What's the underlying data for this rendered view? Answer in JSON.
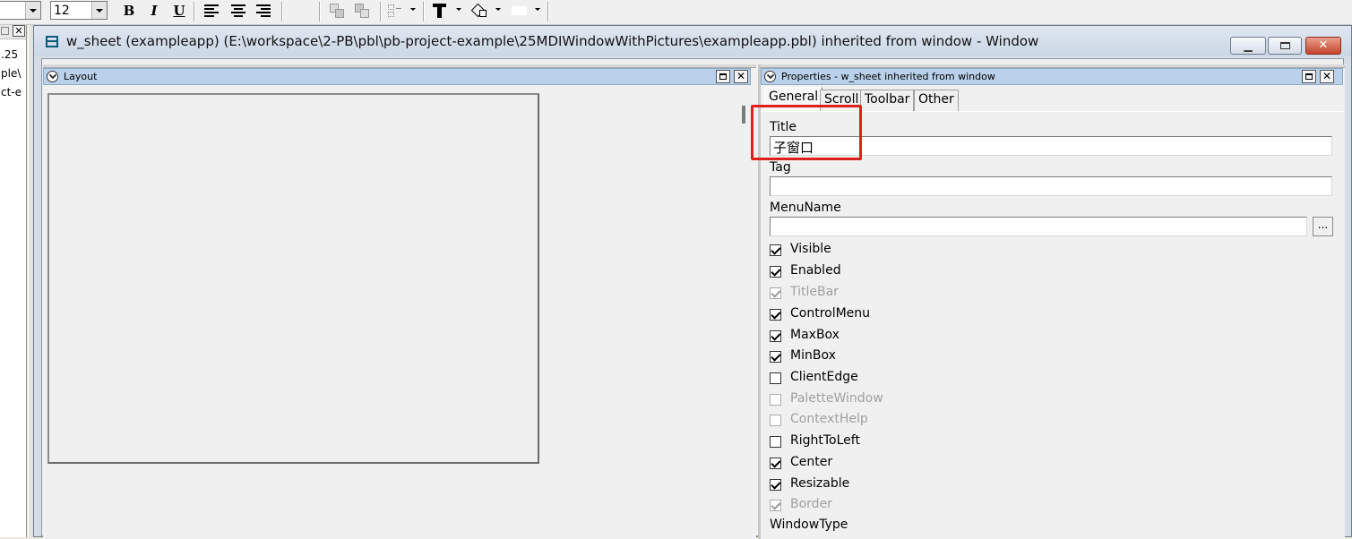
{
  "toolbar": {
    "font_size": "12",
    "bold_label": "B",
    "italic_label": "I",
    "underline_label": "U"
  },
  "left_strip": {
    "lines": [
      ".25",
      "ple\\",
      "ct-e"
    ]
  },
  "sheet": {
    "title": "w_sheet (exampleapp) (E:\\workspace\\2-PB\\pbl\\pb-project-example\\25MDIWindowWithPictures\\exampleapp.pbl) inherited from window - Window"
  },
  "layout_pane": {
    "title": "Layout"
  },
  "properties_pane": {
    "title": "Properties - w_sheet inherited from window",
    "tabs": [
      {
        "label": "General",
        "active": true
      },
      {
        "label": "Scroll",
        "active": false
      },
      {
        "label": "Toolbar",
        "active": false
      },
      {
        "label": "Other",
        "active": false
      }
    ],
    "title_label": "Title",
    "title_value": "子窗口",
    "tag_label": "Tag",
    "tag_value": "",
    "menuname_label": "MenuName",
    "menuname_value": "",
    "ellipsis_label": "...",
    "checkboxes": [
      {
        "label": "Visible",
        "checked": true,
        "enabled": true
      },
      {
        "label": "Enabled",
        "checked": true,
        "enabled": true
      },
      {
        "label": "TitleBar",
        "checked": true,
        "enabled": false
      },
      {
        "label": "ControlMenu",
        "checked": true,
        "enabled": true
      },
      {
        "label": "MaxBox",
        "checked": true,
        "enabled": true
      },
      {
        "label": "MinBox",
        "checked": true,
        "enabled": true
      },
      {
        "label": "ClientEdge",
        "checked": false,
        "enabled": true
      },
      {
        "label": "PaletteWindow",
        "checked": false,
        "enabled": false
      },
      {
        "label": "ContextHelp",
        "checked": false,
        "enabled": false
      },
      {
        "label": "RightToLeft",
        "checked": false,
        "enabled": true
      },
      {
        "label": "Center",
        "checked": true,
        "enabled": true
      },
      {
        "label": "Resizable",
        "checked": true,
        "enabled": true
      },
      {
        "label": "Border",
        "checked": true,
        "enabled": false
      }
    ],
    "windowtype_label": "WindowType"
  },
  "colors": {
    "highlight_box": "#e0201c",
    "pane_header": "#b9d1ea",
    "close_button": "#c6452c"
  }
}
